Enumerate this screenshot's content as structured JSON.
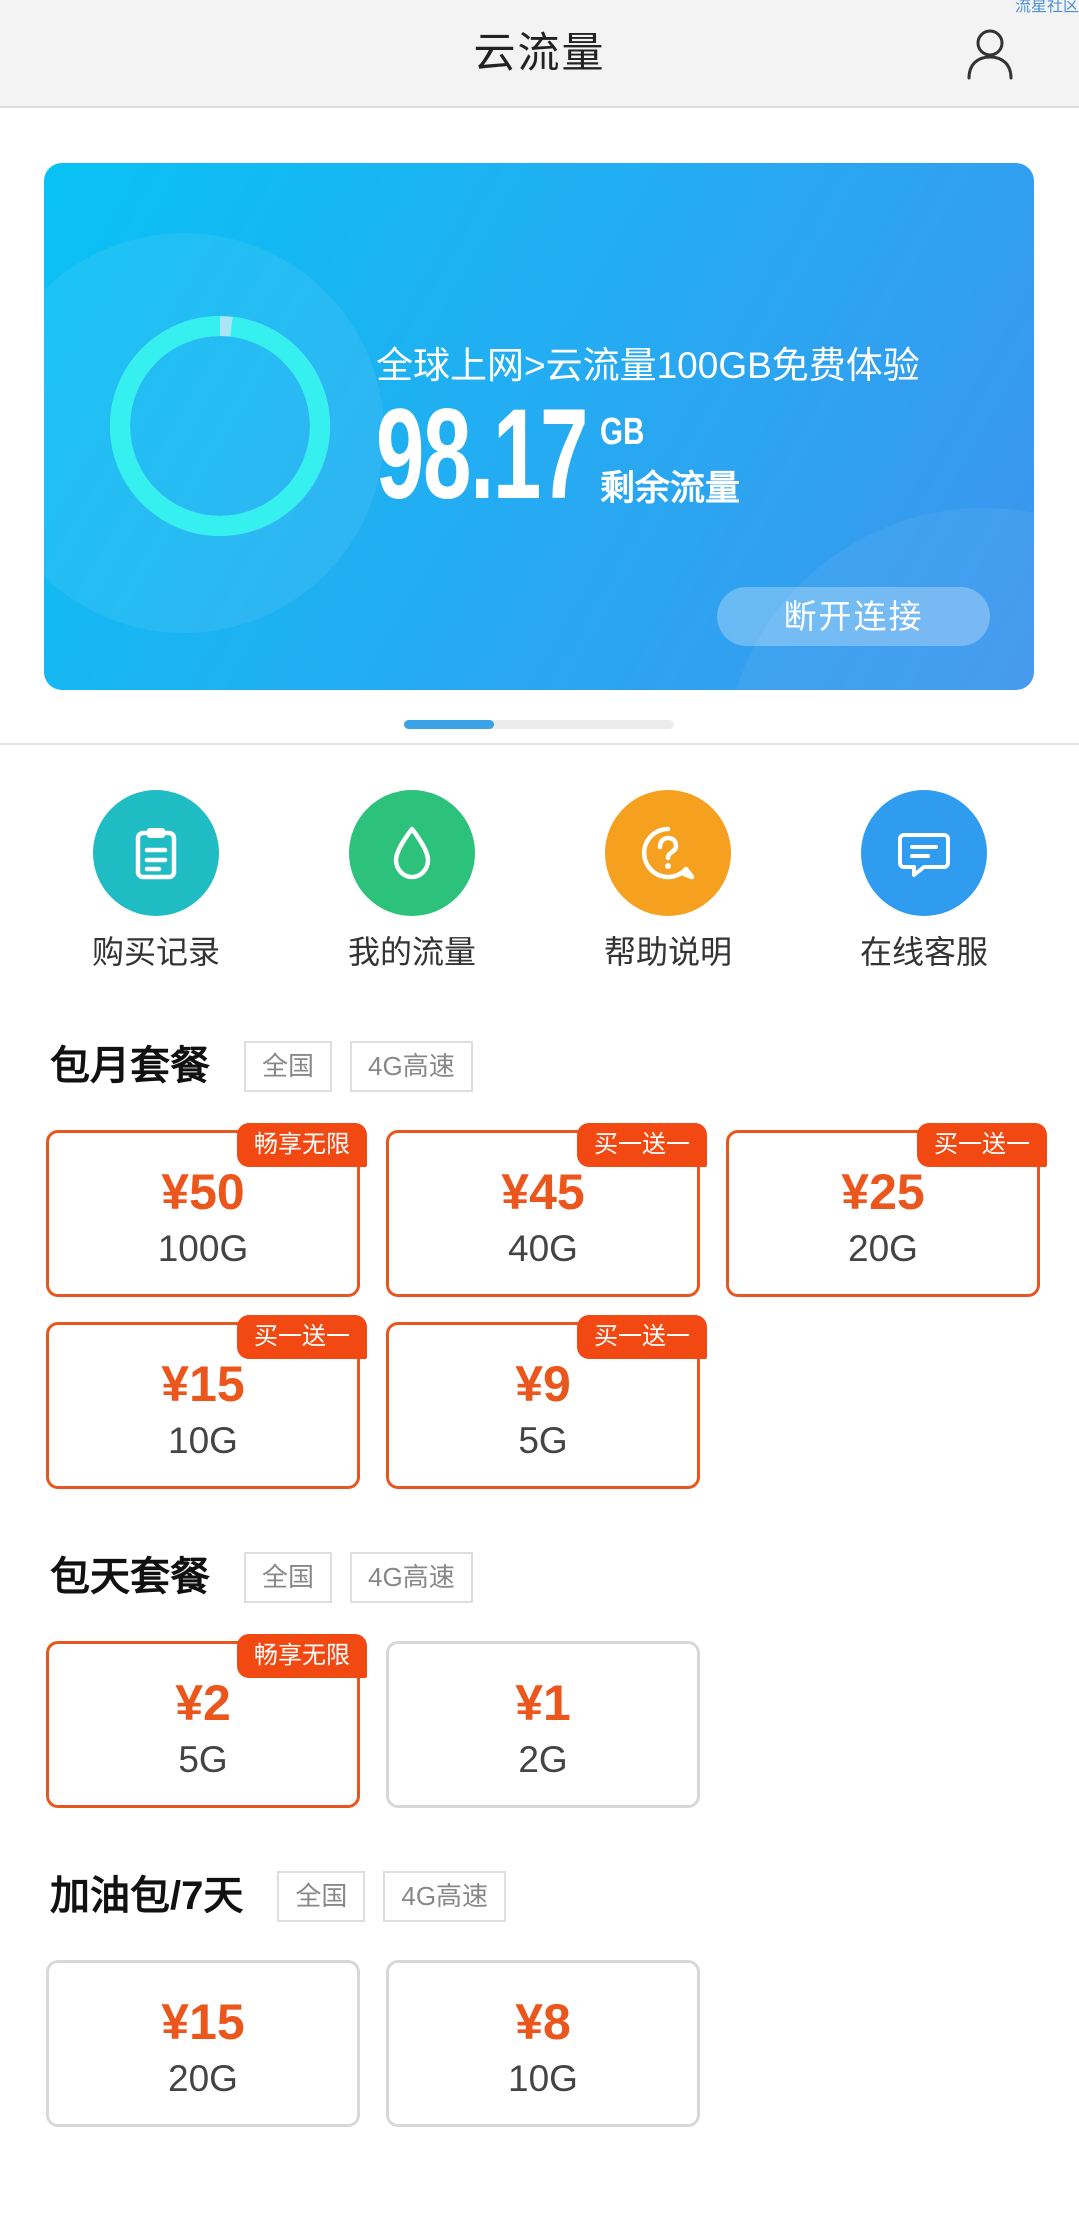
{
  "watermark": "流星社区",
  "header": {
    "title": "云流量",
    "user_icon": "user-icon"
  },
  "banner": {
    "subtitle": "全球上网>云流量100GB免费体验",
    "remaining_value": "98.17",
    "unit": "GB",
    "remaining_label": "剩余流量",
    "disconnect_label": "断开连接",
    "ring_remaining_fraction": 0.9817,
    "ring_color": "#35f0ee",
    "ring_track_color": "#a9e6f5"
  },
  "carousel": {
    "active_index": 0,
    "page_count": 3,
    "active_color": "#3aa2e6"
  },
  "quick_actions": [
    {
      "label": "购买记录",
      "icon": "clipboard-icon",
      "color": "#1fbcc3"
    },
    {
      "label": "我的流量",
      "icon": "drop-icon",
      "color": "#2cc27b"
    },
    {
      "label": "帮助说明",
      "icon": "question-icon",
      "color": "#f6a020"
    },
    {
      "label": "在线客服",
      "icon": "chat-icon",
      "color": "#2f9cf0"
    }
  ],
  "accent_color": "#ea561c",
  "sections": [
    {
      "title": "包月套餐",
      "tags": [
        "全国",
        "4G高速"
      ],
      "plans": [
        {
          "price": "¥50",
          "data": "100G",
          "badge": "畅享无限",
          "highlighted": true
        },
        {
          "price": "¥45",
          "data": "40G",
          "badge": "买一送一",
          "highlighted": true
        },
        {
          "price": "¥25",
          "data": "20G",
          "badge": "买一送一",
          "highlighted": true
        },
        {
          "price": "¥15",
          "data": "10G",
          "badge": "买一送一",
          "highlighted": true
        },
        {
          "price": "¥9",
          "data": "5G",
          "badge": "买一送一",
          "highlighted": true
        }
      ]
    },
    {
      "title": "包天套餐",
      "tags": [
        "全国",
        "4G高速"
      ],
      "plans": [
        {
          "price": "¥2",
          "data": "5G",
          "badge": "畅享无限",
          "highlighted": true
        },
        {
          "price": "¥1",
          "data": "2G",
          "highlighted": false
        }
      ]
    },
    {
      "title": "加油包/7天",
      "tags": [
        "全国",
        "4G高速"
      ],
      "plans": [
        {
          "price": "¥15",
          "data": "20G",
          "highlighted": false
        },
        {
          "price": "¥8",
          "data": "10G",
          "highlighted": false
        }
      ]
    }
  ]
}
